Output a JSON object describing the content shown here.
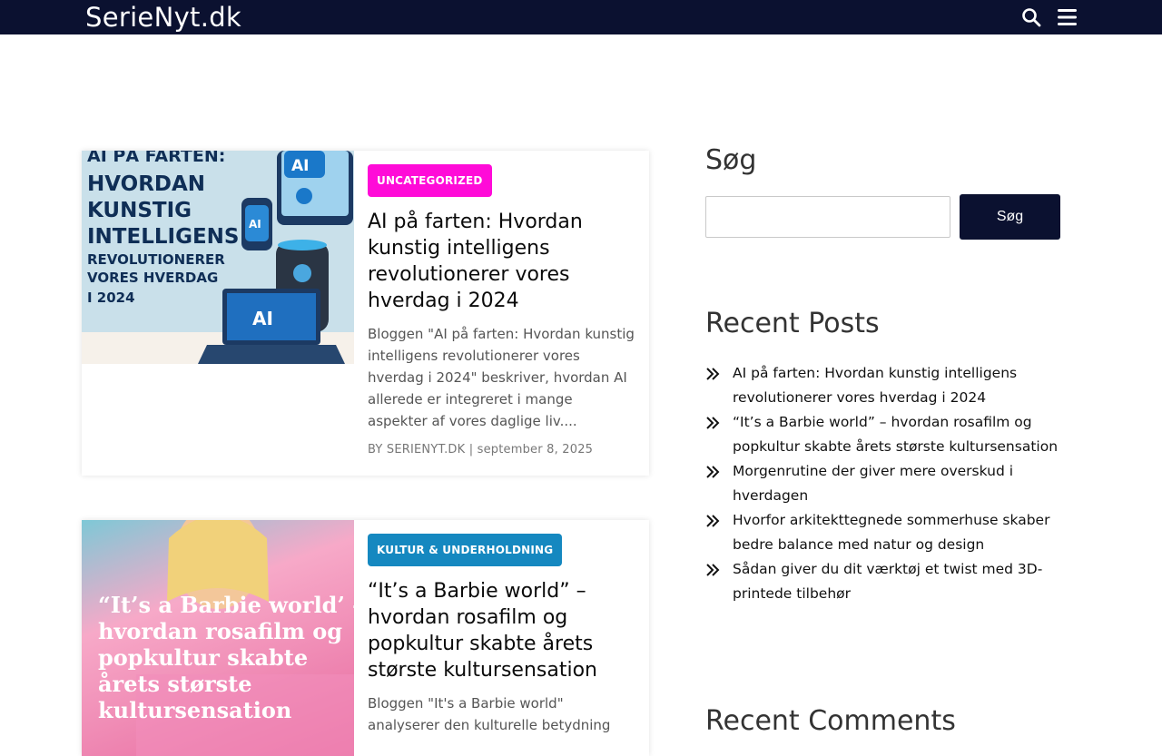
{
  "header": {
    "logo": "SerieNyt.dk",
    "search_icon": "search-icon",
    "menu_icon": "hamburger-menu-icon",
    "bg_color": "#0b1130"
  },
  "posts": [
    {
      "category": "UNCATEGORIZED",
      "category_color": "#ff0bd8",
      "title": "AI på farten: Hvordan kunstig intelligens revolutionerer vores hverdag i 2024",
      "excerpt": "Bloggen \"AI på farten: Hvordan kunstig intelligens revolutionerer vores hverdag i 2024\" beskriver, hvordan AI allerede er integreret i mange aspekter af vores daglige liv....",
      "meta": "BY SERIENYT.DK | september 8, 2025",
      "image_text": {
        "line1": "AI PÅ FARTEN:",
        "line2": "HVORDAN",
        "line3": "KUNSTIG",
        "line4": "INTELLIGENS",
        "line5": "REVOLUTIONERER",
        "line6": "VORES HVERDAG",
        "line7": "I 2024",
        "chip": "AI",
        "bubble": "AI",
        "laptop": "AI"
      }
    },
    {
      "category": "KULTUR & UNDERHOLDNING",
      "category_color": "#1588c0",
      "title": "“It’s a Barbie world” – hvordan rosafilm og popkultur skabte årets største kultursensation",
      "excerpt": "Bloggen \"It's a Barbie world\" analyserer den kulturelle betydning",
      "image_text": {
        "line1": "“It’s a Barbie world’ –",
        "line2": "hvordan rosafilm og",
        "line3": "popkultur skabte",
        "line4": "årets største",
        "line5": "kultursensation"
      }
    }
  ],
  "sidebar": {
    "search_title": "Søg",
    "search_button": "Søg",
    "search_value": "",
    "recent_title": "Recent Posts",
    "recent_posts": [
      "AI på farten: Hvordan kunstig intelligens revolutionerer vores hverdag i 2024",
      "“It’s a Barbie world” – hvordan rosafilm og popkultur skabte årets største kultursensation",
      "Morgenrutine der giver mere overskud i hverdagen",
      "Hvorfor arkitekttegnede sommerhuse skaber bedre balance med natur og design",
      "Sådan giver du dit værktøj et twist med 3D-printede tilbehør"
    ],
    "comments_title": "Recent Comments"
  }
}
